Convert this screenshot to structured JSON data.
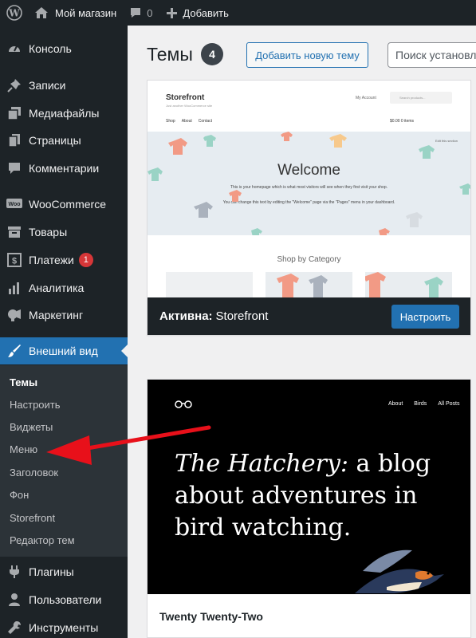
{
  "adminbar": {
    "site_name": "Мой магазин",
    "comments_count": "0",
    "new_label": "Добавить"
  },
  "sidebar": {
    "items": [
      {
        "label": "Консоль",
        "icon": "dashboard-icon"
      },
      {
        "label": "Записи",
        "icon": "pin-icon"
      },
      {
        "label": "Медиафайлы",
        "icon": "media-icon"
      },
      {
        "label": "Страницы",
        "icon": "pages-icon"
      },
      {
        "label": "Комментарии",
        "icon": "comment-icon"
      },
      {
        "label": "WooCommerce",
        "icon": "woo-icon"
      },
      {
        "label": "Товары",
        "icon": "archive-icon"
      },
      {
        "label": "Платежи",
        "icon": "dollar-icon",
        "badge": "1"
      },
      {
        "label": "Аналитика",
        "icon": "bar-chart-icon"
      },
      {
        "label": "Маркетинг",
        "icon": "megaphone-icon"
      },
      {
        "label": "Внешний вид",
        "icon": "brush-icon",
        "active": true
      },
      {
        "label": "Плагины",
        "icon": "plugin-icon"
      },
      {
        "label": "Пользователи",
        "icon": "users-icon"
      },
      {
        "label": "Инструменты",
        "icon": "wrench-icon"
      }
    ],
    "submenu": [
      "Темы",
      "Настроить",
      "Виджеты",
      "Меню",
      "Заголовок",
      "Фон",
      "Storefront",
      "Редактор тем"
    ]
  },
  "main": {
    "title": "Темы",
    "count": "4",
    "add_button": "Добавить новую тему",
    "search_placeholder": "Поиск установленных тем..."
  },
  "themes": [
    {
      "name": "Storefront",
      "active_prefix": "Активна:",
      "customize_label": "Настроить",
      "preview": {
        "logo": "Storefront",
        "tagline": "Just another WooCommerce site",
        "account": "My Account",
        "search": "Search products...",
        "nav": [
          "Shop",
          "About",
          "Contact"
        ],
        "cart": "$0.00  0 items",
        "edit": "Edit this section",
        "welcome": "Welcome",
        "p1": "This is your homepage which is what most visitors will see when they first visit your shop.",
        "p2": "You can change this text by editing the \"Welcome\" page via the \"Pages\" menu in your dashboard.",
        "category_title": "Shop by Category"
      }
    },
    {
      "name": "Twenty Twenty-Two",
      "preview": {
        "nav": [
          "About",
          "Birds",
          "All Posts"
        ],
        "headline_italic": "The Hatchery:",
        "headline_rest": " a blog about adventures in bird watching."
      }
    }
  ],
  "colors": {
    "admin_dark": "#1d2327",
    "accent_blue": "#2271b1",
    "badge_red": "#d63638",
    "arrow_red": "#e8101a"
  }
}
